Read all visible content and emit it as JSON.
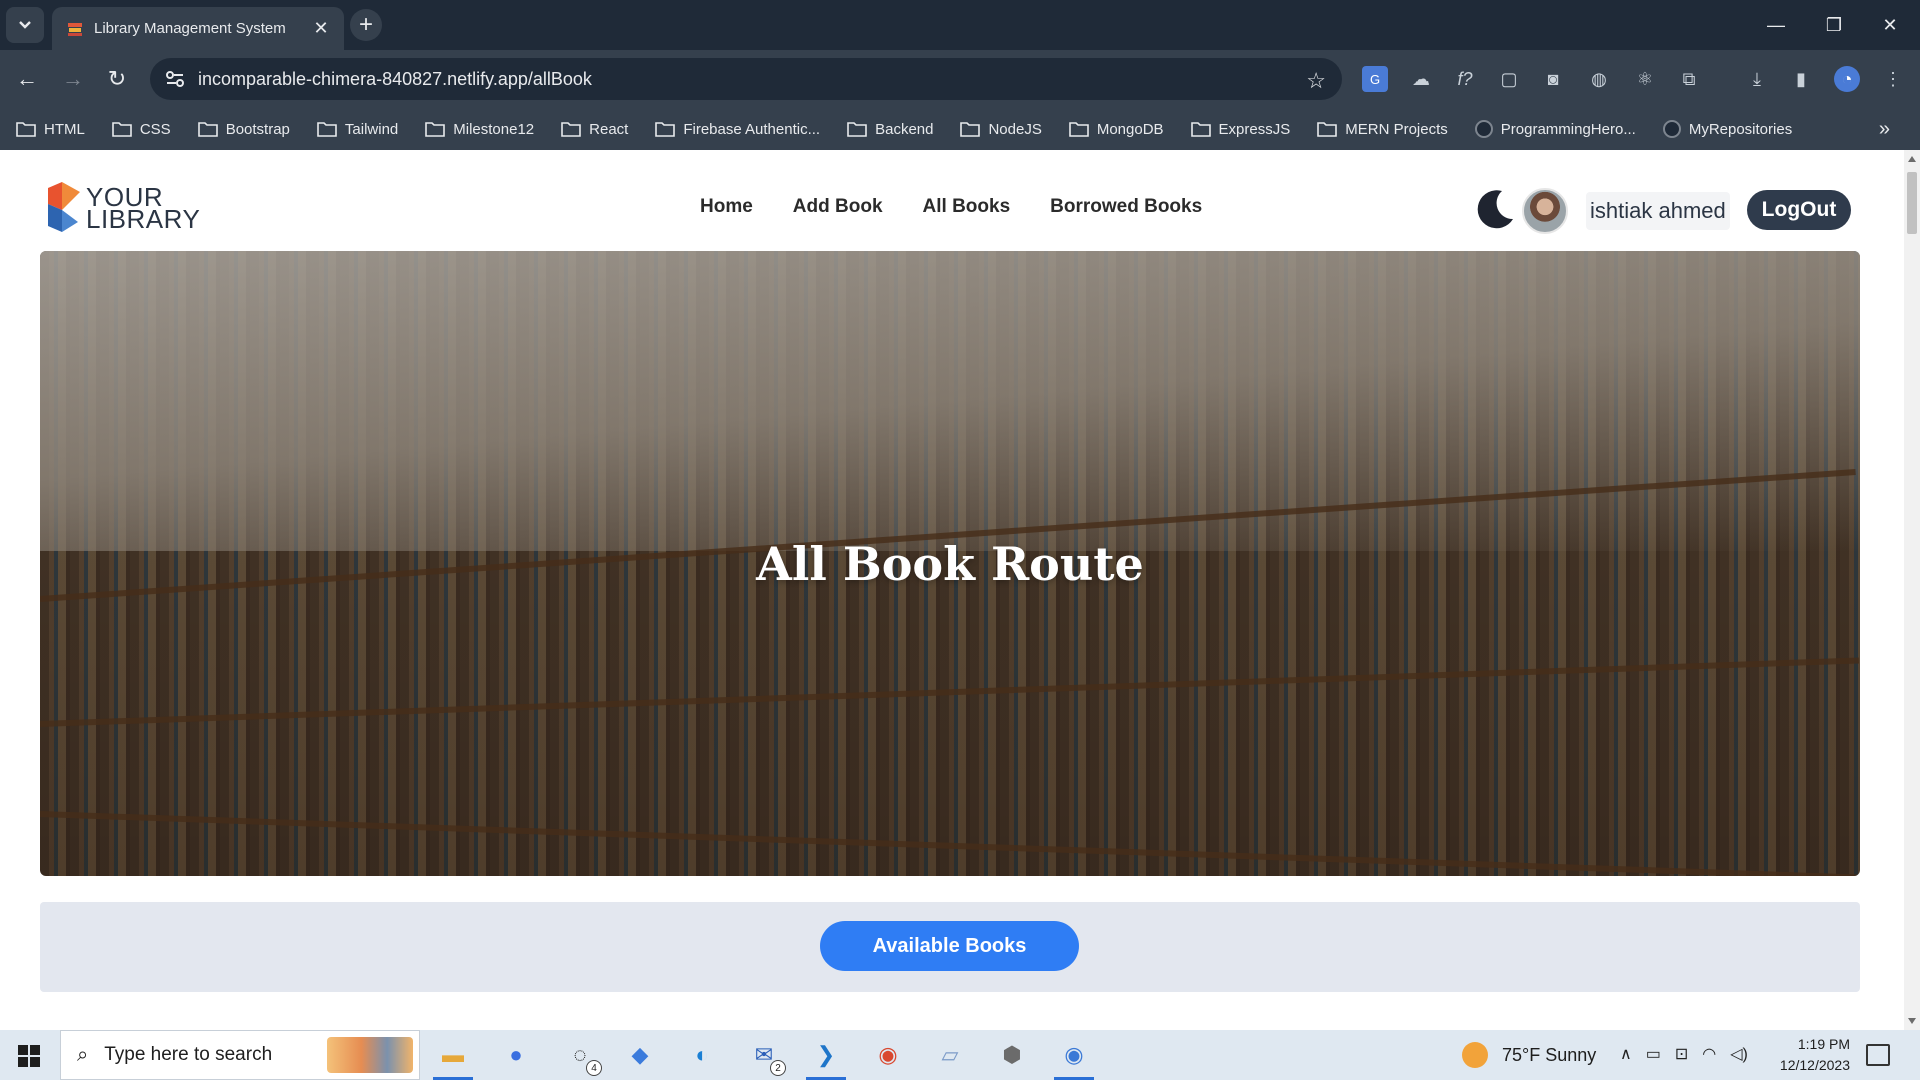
{
  "browser": {
    "tab_title": "Library Management System",
    "url": "incomparable-chimera-840827.netlify.app/allBook",
    "bookmarks": [
      {
        "label": "HTML",
        "type": "folder"
      },
      {
        "label": "CSS",
        "type": "folder"
      },
      {
        "label": "Bootstrap",
        "type": "folder"
      },
      {
        "label": "Tailwind",
        "type": "folder"
      },
      {
        "label": "Milestone12",
        "type": "folder"
      },
      {
        "label": "React",
        "type": "folder"
      },
      {
        "label": "Firebase Authentic...",
        "type": "folder"
      },
      {
        "label": "Backend",
        "type": "folder"
      },
      {
        "label": "NodeJS",
        "type": "folder"
      },
      {
        "label": "MongoDB",
        "type": "folder"
      },
      {
        "label": "ExpressJS",
        "type": "folder"
      },
      {
        "label": "MERN Projects",
        "type": "folder"
      },
      {
        "label": "ProgrammingHero...",
        "type": "github"
      },
      {
        "label": "MyRepositories",
        "type": "github"
      }
    ]
  },
  "site": {
    "logo_line1": "YOUR",
    "logo_line2": "LIBRARY",
    "nav": [
      "Home",
      "Add Book",
      "All Books",
      "Borrowed Books"
    ],
    "username": "ishtiak ahmed",
    "logout_label": "LogOut",
    "banner_title": "All Book Route",
    "available_books_label": "Available Books",
    "accent_color": "#2f7df4"
  },
  "taskbar": {
    "search_placeholder": "Type here to search",
    "weather": "75°F  Sunny",
    "time": "1:19 PM",
    "date": "12/12/2023",
    "whatsapp_badge": "4",
    "mail_badge": "2"
  }
}
